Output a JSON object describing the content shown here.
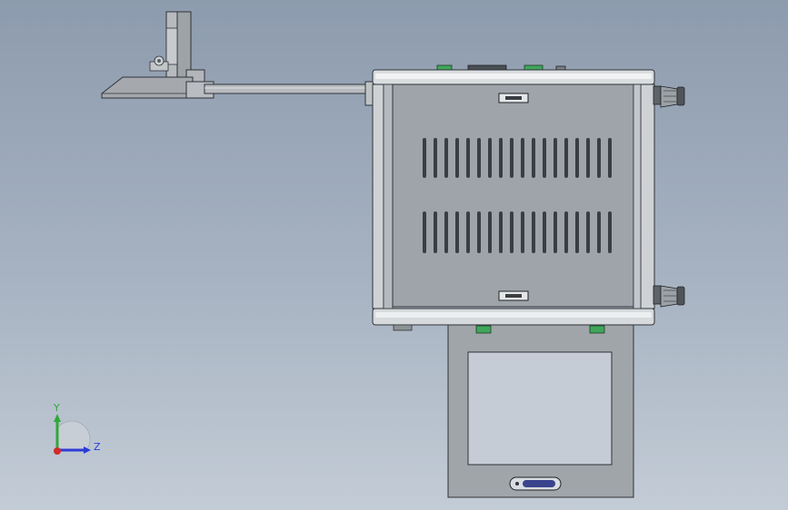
{
  "scene": {
    "background_top": "#8d9bae",
    "background_bottom": "#c3ccd6",
    "metal_light": "#d7dadd",
    "metal_mid": "#a9aeb3",
    "metal_dark": "#3b3f44",
    "panel_fill": "#9ea4aa",
    "connector_green": "#3fa65a",
    "handle_blue": "#39448c"
  },
  "triad": {
    "y_label": "Y",
    "z_label": "Z",
    "y_color": "#2fa83a",
    "z_color": "#2b3bd8",
    "origin_color": "#d12a2a"
  }
}
